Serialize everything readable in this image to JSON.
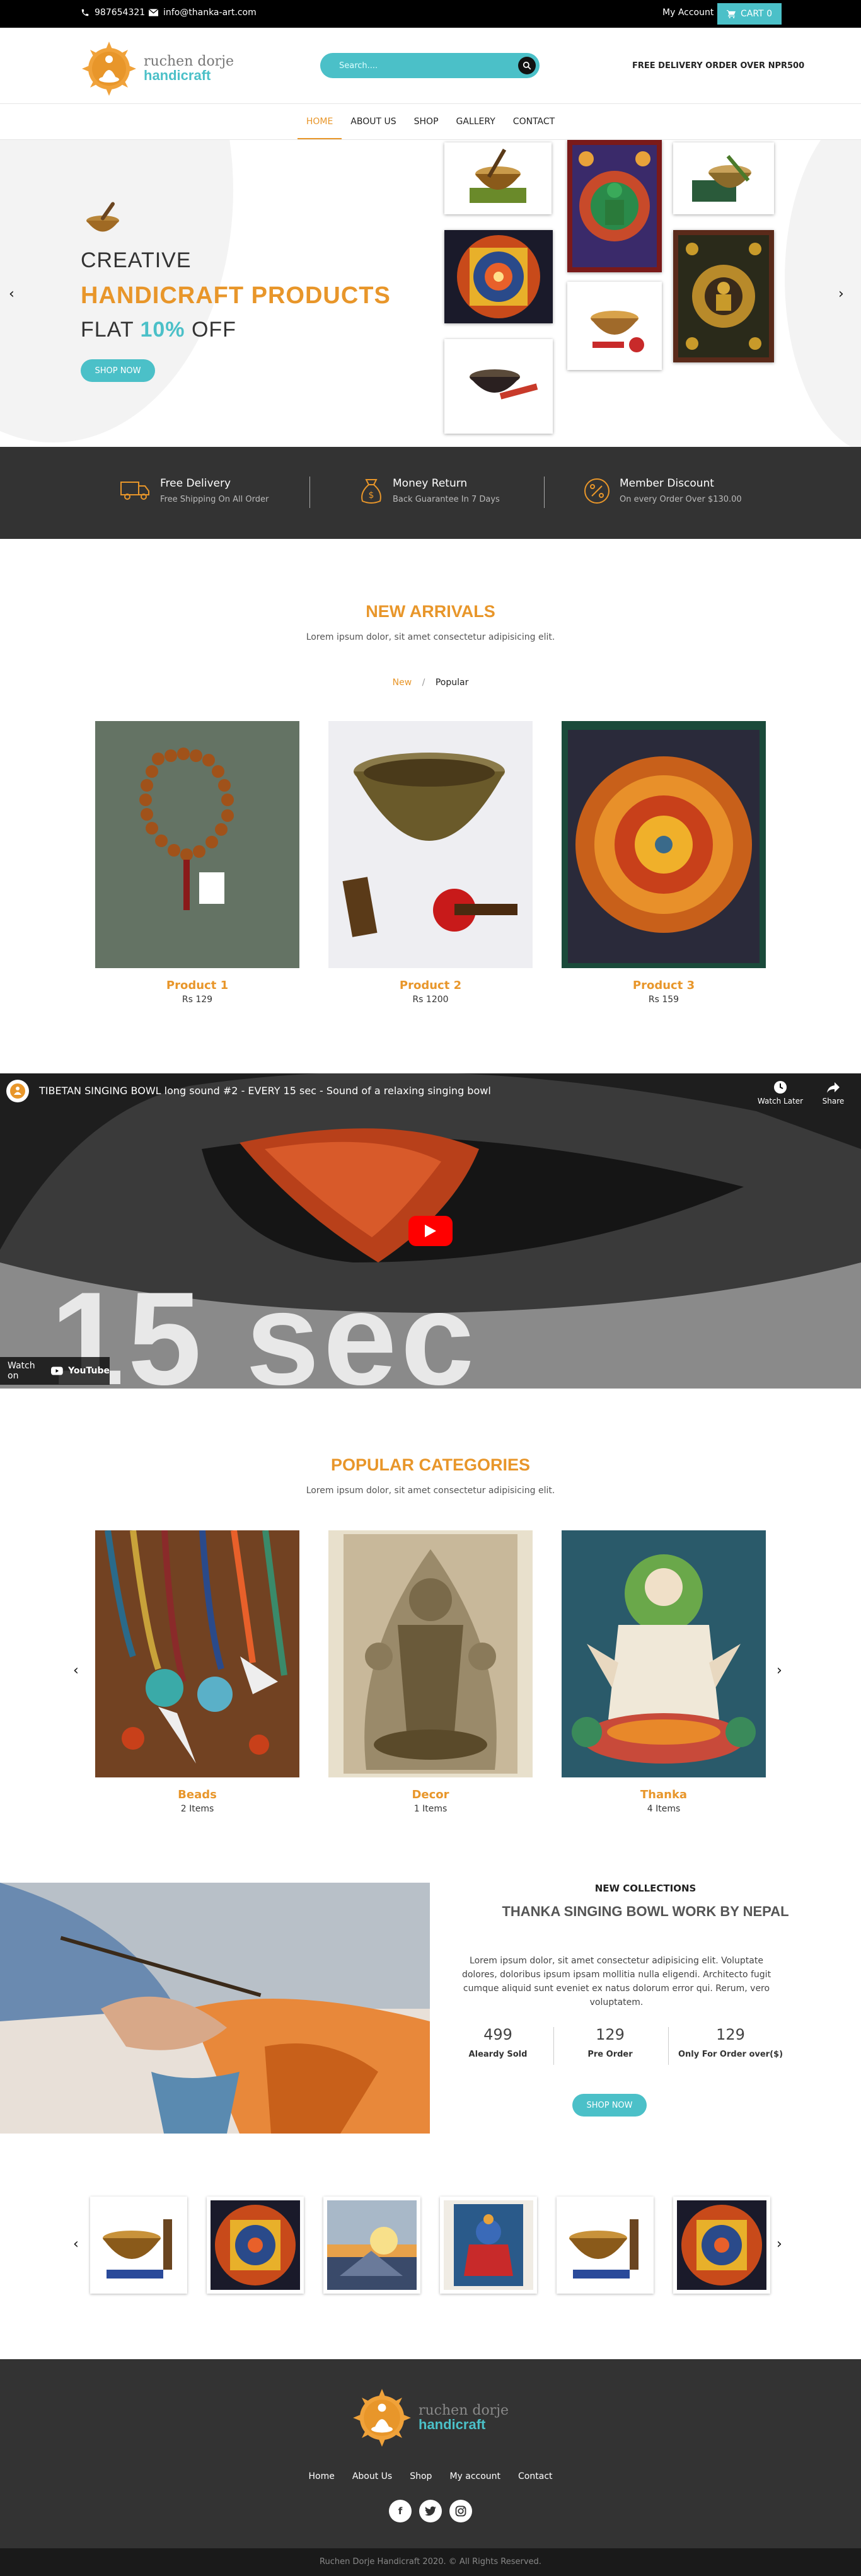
{
  "topbar": {
    "phone": "987654321",
    "email": "info@thanka-art.com",
    "my_account": "My Account",
    "cart": "CART 0"
  },
  "header": {
    "logo_line1": "ruchen dorje",
    "logo_line2": "handicraft",
    "search_placeholder": "Search....",
    "promo": "FREE DELIVERY ORDER OVER NPR500"
  },
  "nav": {
    "items": [
      {
        "label": "HOME"
      },
      {
        "label": "ABOUT US"
      },
      {
        "label": "SHOP"
      },
      {
        "label": "GALLERY"
      },
      {
        "label": "CONTACT"
      }
    ]
  },
  "hero": {
    "line1": "CREATIVE",
    "line2": "HANDICRAFT PRODUCTS",
    "line3_pre": "FLAT ",
    "line3_pct": "10%",
    "line3_post": " OFF",
    "button": "SHOP NOW"
  },
  "features": [
    {
      "title": "Free Delivery",
      "subtitle": "Free Shipping On All Order",
      "icon": "truck-icon"
    },
    {
      "title": "Money Return",
      "subtitle": "Back Guarantee In 7 Days",
      "icon": "money-bag-icon"
    },
    {
      "title": "Member Discount",
      "subtitle": "On every Order Over $130.00",
      "icon": "percent-icon"
    }
  ],
  "new_arrivals": {
    "title": "NEW ARRIVALS",
    "subtitle": "Lorem ipsum dolor, sit amet consectetur adipisicing elit.",
    "tab_new": "New",
    "tab_sep": "/",
    "tab_popular": "Popular",
    "products": [
      {
        "name": "Product 1",
        "price": "Rs 129"
      },
      {
        "name": "Product 2",
        "price": "Rs 1200"
      },
      {
        "name": "Product 3",
        "price": "Rs 159"
      }
    ]
  },
  "video": {
    "title": "TIBETAN SINGING BOWL long sound #2 - EVERY 15 sec - Sound of a relaxing singing bowl",
    "watch_later": "Watch Later",
    "share": "Share",
    "watch_on": "Watch on",
    "youtube": "YouTube",
    "overlay_text": "15 sec"
  },
  "categories": {
    "title": "POPULAR CATEGORIES",
    "subtitle": "Lorem ipsum dolor, sit amet consectetur adipisicing elit.",
    "items": [
      {
        "name": "Beads",
        "count": "2 Items"
      },
      {
        "name": "Decor",
        "count": "1 Items"
      },
      {
        "name": "Thanka",
        "count": "4 Items"
      }
    ]
  },
  "collection": {
    "kicker": "NEW COLLECTIONS",
    "title": "THANKA SINGING BOWL WORK BY NEPAL",
    "body": "Lorem ipsum dolor, sit amet consectetur adipisicing elit. Voluptate dolores, doloribus ipsum ipsam mollitia nulla eligendi. Architecto fugit cumque aliquid sunt eveniet ex natus dolorum error qui. Rerum, vero voluptatem.",
    "stats": [
      {
        "number": "499",
        "label": "Aleardy Sold"
      },
      {
        "number": "129",
        "label": "Pre Order"
      },
      {
        "number": "129",
        "label": "Only For Order over($)"
      }
    ],
    "button": "SHOP NOW"
  },
  "footer": {
    "logo_line1": "ruchen dorje",
    "logo_line2": "handicraft",
    "links": [
      "Home",
      "About Us",
      "Shop",
      "My account",
      "Contact"
    ],
    "social": [
      "f",
      "t",
      "ig"
    ],
    "copyright": "Ruchen Dorje Handicraft 2020. © All Rights Reserved."
  },
  "colors": {
    "accent_orange": "#e8962a",
    "accent_teal": "#4bc0c8",
    "dark": "#333333"
  }
}
